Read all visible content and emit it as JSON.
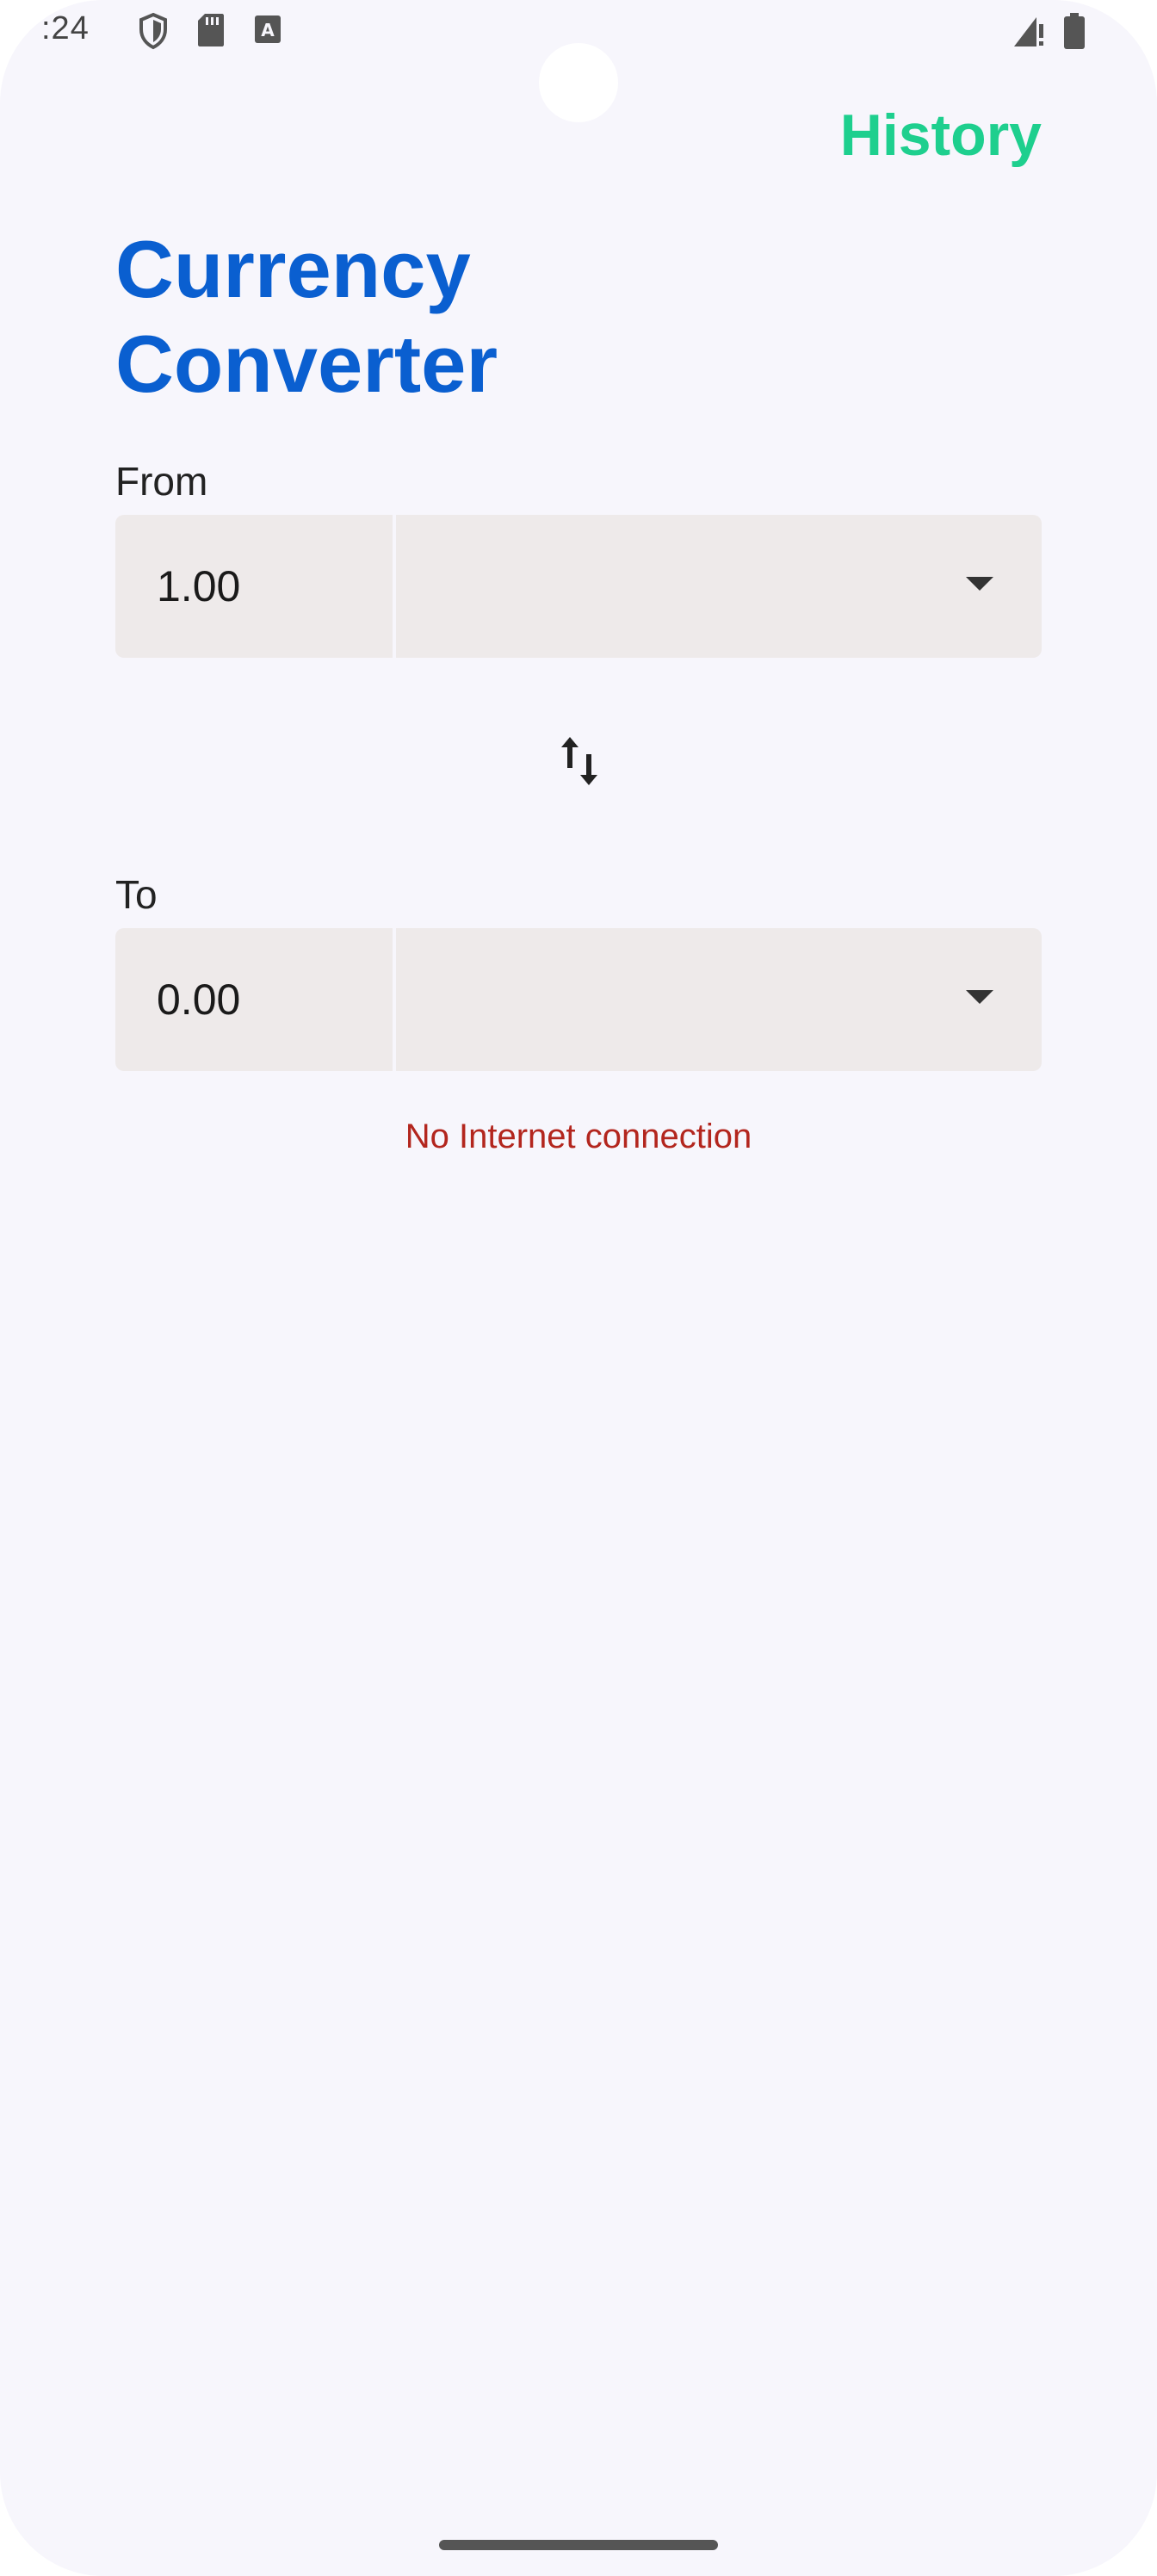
{
  "status_bar": {
    "time": ":24",
    "icons": [
      "vpn-shield-icon",
      "sd-card-icon",
      "keyboard-a-icon",
      "signal-off-icon",
      "battery-icon"
    ]
  },
  "header": {
    "history_label": "History",
    "history_color": "#1ecf8e"
  },
  "title": {
    "line1": "Currency",
    "line2": "Converter",
    "color": "#0a5fd0"
  },
  "from": {
    "label": "From",
    "amount": "1.00",
    "currency": ""
  },
  "swap": {
    "icon": "swap-vertical-icon"
  },
  "to": {
    "label": "To",
    "amount": "0.00",
    "currency": ""
  },
  "error": {
    "message": "No Internet connection",
    "color": "#b3261e"
  }
}
